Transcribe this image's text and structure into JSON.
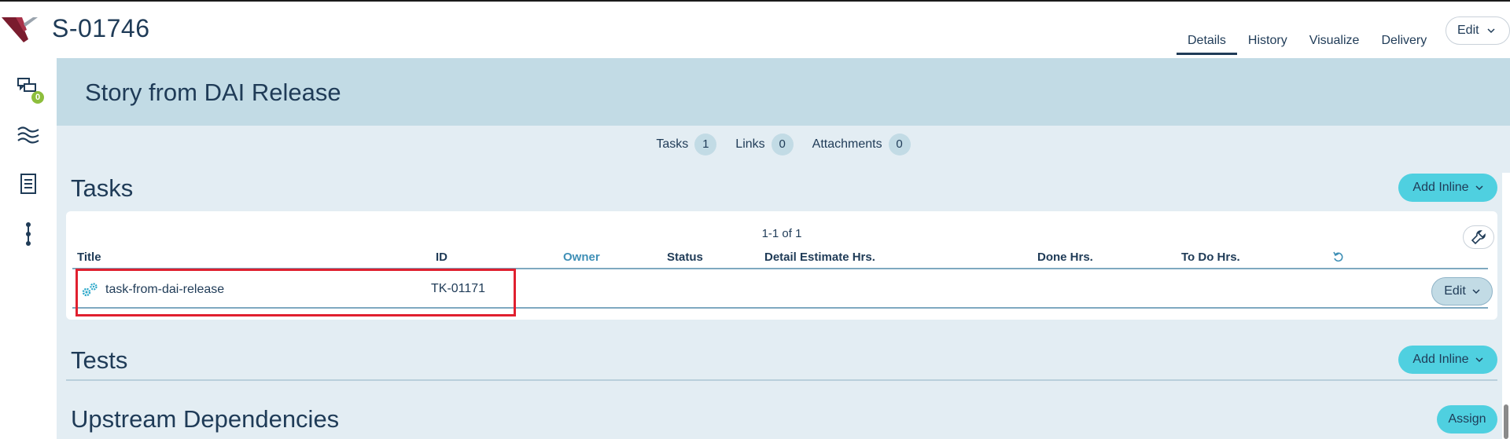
{
  "header": {
    "story_id": "S-01746",
    "tabs": [
      "Details",
      "History",
      "Visualize",
      "Delivery"
    ],
    "active_tab": "Details",
    "edit_label": "Edit"
  },
  "rail": {
    "icons": [
      "conversations-icon",
      "waves-icon",
      "document-icon",
      "dependency-icon"
    ],
    "conversation_badge": "0"
  },
  "banner": {
    "title": "Story from DAI Release"
  },
  "counts": {
    "tasks_label": "Tasks",
    "tasks_value": "1",
    "links_label": "Links",
    "links_value": "0",
    "attachments_label": "Attachments",
    "attachments_value": "0"
  },
  "tasks": {
    "title": "Tasks",
    "add_inline_label": "Add Inline",
    "pager": "1-1 of 1",
    "columns": [
      "Title",
      "ID",
      "Owner",
      "Status",
      "Detail Estimate Hrs.",
      "Done Hrs.",
      "To Do Hrs."
    ],
    "rows": [
      {
        "title": "task-from-dai-release",
        "id": "TK-01171",
        "edit_label": "Edit"
      }
    ]
  },
  "tests": {
    "title": "Tests",
    "add_inline_label": "Add Inline"
  },
  "upstream": {
    "title": "Upstream Dependencies",
    "assign_label": "Assign"
  },
  "colors": {
    "accent": "#4fd0e0",
    "banner": "#c2dbe5",
    "background": "#e3edf3",
    "text": "#1f3b57",
    "highlight": "#e0202f",
    "badge": "#8dbe3c"
  }
}
